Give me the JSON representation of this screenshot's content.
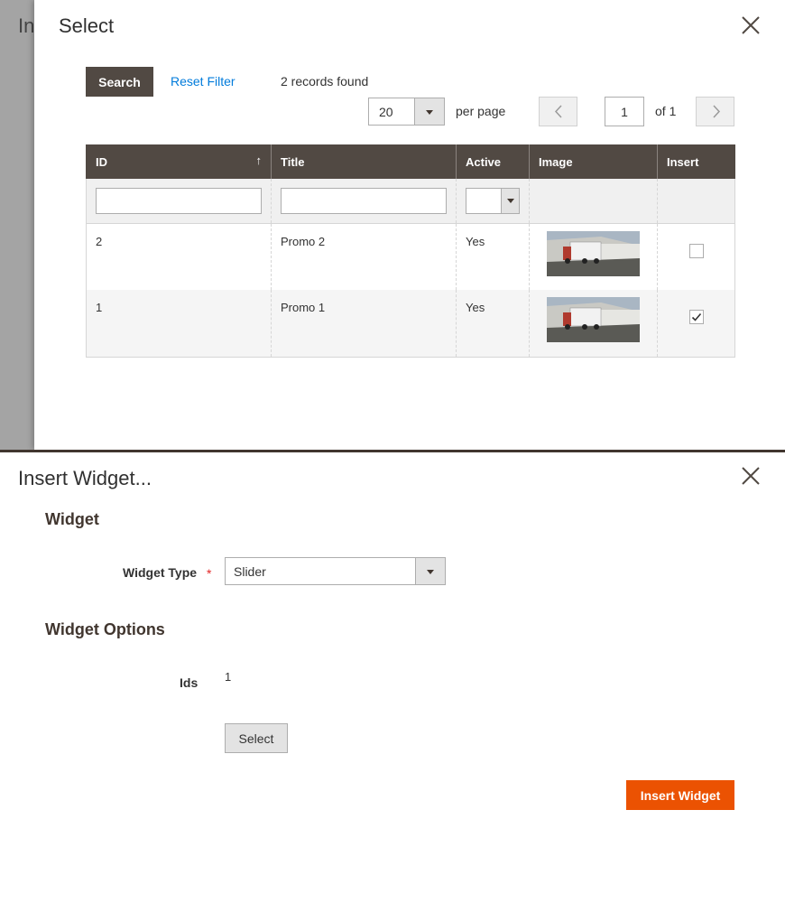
{
  "backdrop": {
    "title": "In"
  },
  "select_modal": {
    "title": "Select",
    "toolbar": {
      "search_label": "Search",
      "reset_filter_label": "Reset Filter",
      "records_found": "2 records found",
      "per_page_value": "20",
      "per_page_label": "per page",
      "current_page": "1",
      "page_of": "of 1"
    },
    "grid": {
      "columns": [
        "ID",
        "Title",
        "Active",
        "Image",
        "Insert"
      ],
      "sort_indicator": "↑",
      "rows": [
        {
          "id": "2",
          "title": "Promo 2",
          "active": "Yes",
          "insert_checked": false
        },
        {
          "id": "1",
          "title": "Promo 1",
          "active": "Yes",
          "insert_checked": true
        }
      ]
    }
  },
  "insert_widget": {
    "title": "Insert Widget...",
    "widget_heading": "Widget",
    "widget_type_label": "Widget Type",
    "required_mark": "*",
    "widget_type_value": "Slider",
    "options_heading": "Widget Options",
    "ids_label": "Ids",
    "ids_value": "1",
    "select_button": "Select",
    "insert_button": "Insert Widget"
  },
  "colors": {
    "header_bg": "#514943",
    "link": "#007bdb",
    "primary_action": "#eb5202",
    "required": "#e22626"
  }
}
